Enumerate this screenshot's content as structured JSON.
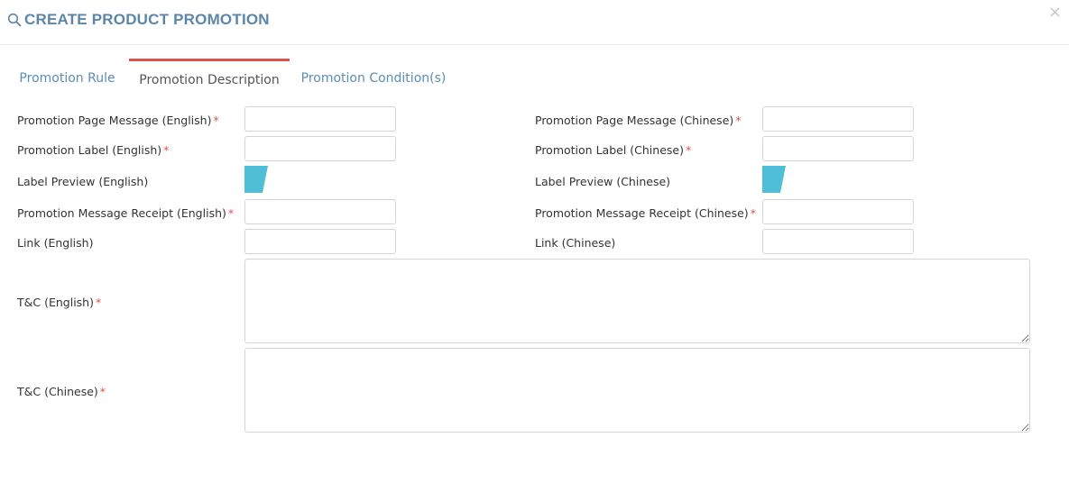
{
  "header": {
    "title": "CREATE PRODUCT PROMOTION",
    "close_label": "×",
    "icon": "search-icon"
  },
  "tabs": [
    {
      "label": "Promotion Rule",
      "active": false
    },
    {
      "label": "Promotion Description",
      "active": true
    },
    {
      "label": "Promotion Condition(s)",
      "active": false
    }
  ],
  "form": {
    "page_message_en": {
      "label": "Promotion Page Message (English)",
      "value": ""
    },
    "page_message_zh": {
      "label": "Promotion Page Message (Chinese)",
      "value": ""
    },
    "label_en": {
      "label": "Promotion Label (English)",
      "value": ""
    },
    "label_zh": {
      "label": "Promotion Label (Chinese)",
      "value": ""
    },
    "preview_en": {
      "label": "Label Preview (English)"
    },
    "preview_zh": {
      "label": "Label Preview (Chinese)"
    },
    "receipt_en": {
      "label": "Promotion Message Receipt (English)",
      "value": ""
    },
    "receipt_zh": {
      "label": "Promotion Message Receipt (Chinese)",
      "value": ""
    },
    "link_en": {
      "label": "Link (English)",
      "value": ""
    },
    "link_zh": {
      "label": "Link (Chinese)",
      "value": ""
    },
    "tc_en": {
      "label": "T&C (English)",
      "value": ""
    },
    "tc_zh": {
      "label": "T&C (Chinese)",
      "value": ""
    },
    "required_marker": "*"
  },
  "colors": {
    "accent": "#5a8db7",
    "title": "#5b86ac",
    "active_tab_border": "#d9534f",
    "required": "#d9534f",
    "preview_fill": "#4fbfd8"
  }
}
